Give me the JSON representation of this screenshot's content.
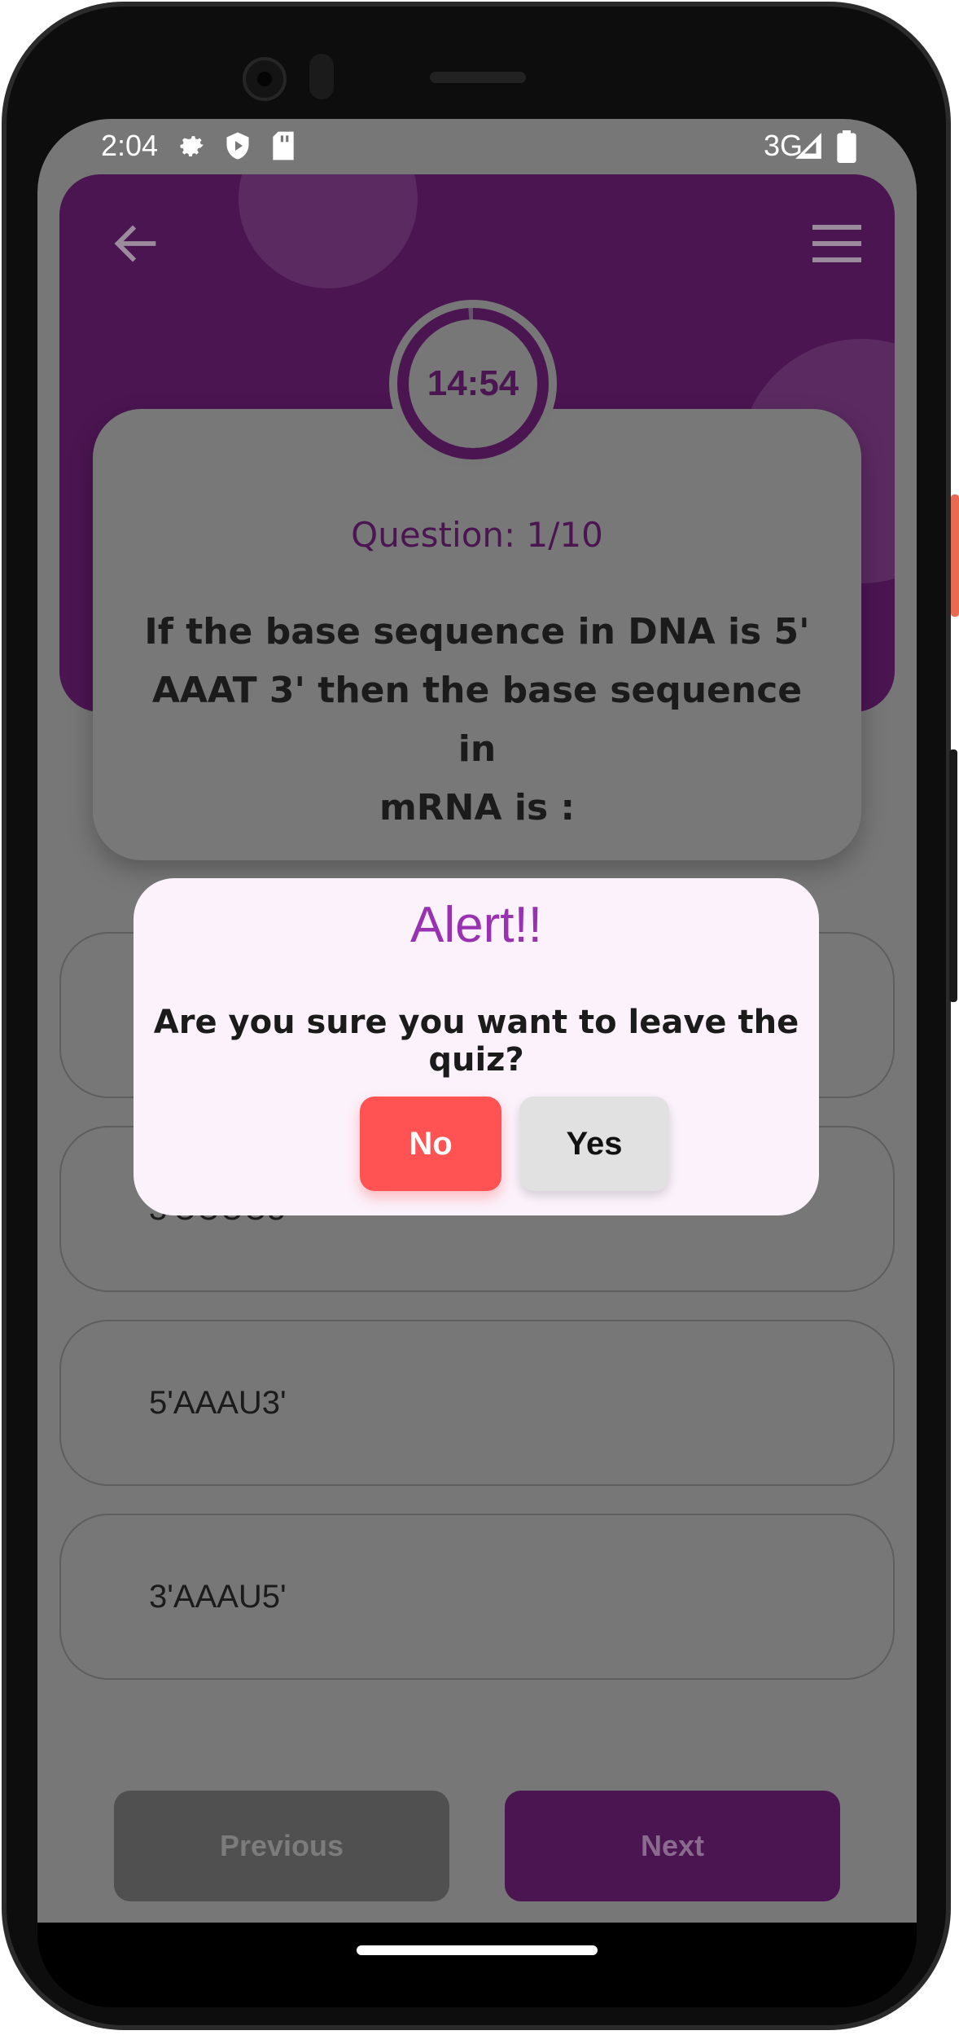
{
  "status_bar": {
    "time": "2:04",
    "network": "3G",
    "icons": [
      "settings-icon",
      "shield-play-icon",
      "sd-card-icon",
      "signal-icon",
      "battery-icon"
    ]
  },
  "header": {
    "back_icon": "arrow-left-icon",
    "menu_icon": "hamburger-menu-icon"
  },
  "timer": {
    "text": "14:54",
    "remaining_fraction": 0.99
  },
  "question": {
    "counter": "Question: 1/10",
    "line1": "If the base sequence in DNA is 5'",
    "line2": "AAAT 3' then the base sequence in",
    "line3": "mRNA is :"
  },
  "options": [
    {
      "label": ""
    },
    {
      "label": "3'UUUU5'"
    },
    {
      "label": "5'AAAU3'"
    },
    {
      "label": "3'AAAU5'"
    }
  ],
  "navigation": {
    "previous_label": "Previous",
    "next_label": "Next"
  },
  "dialog": {
    "title": "Alert!!",
    "message": "Are you sure you want to leave the quiz?",
    "no_label": "No",
    "yes_label": "Yes"
  },
  "colors": {
    "primary": "#4b1552",
    "accent": "#9932b0",
    "danger": "#ff5252",
    "overlay": "#777777"
  }
}
